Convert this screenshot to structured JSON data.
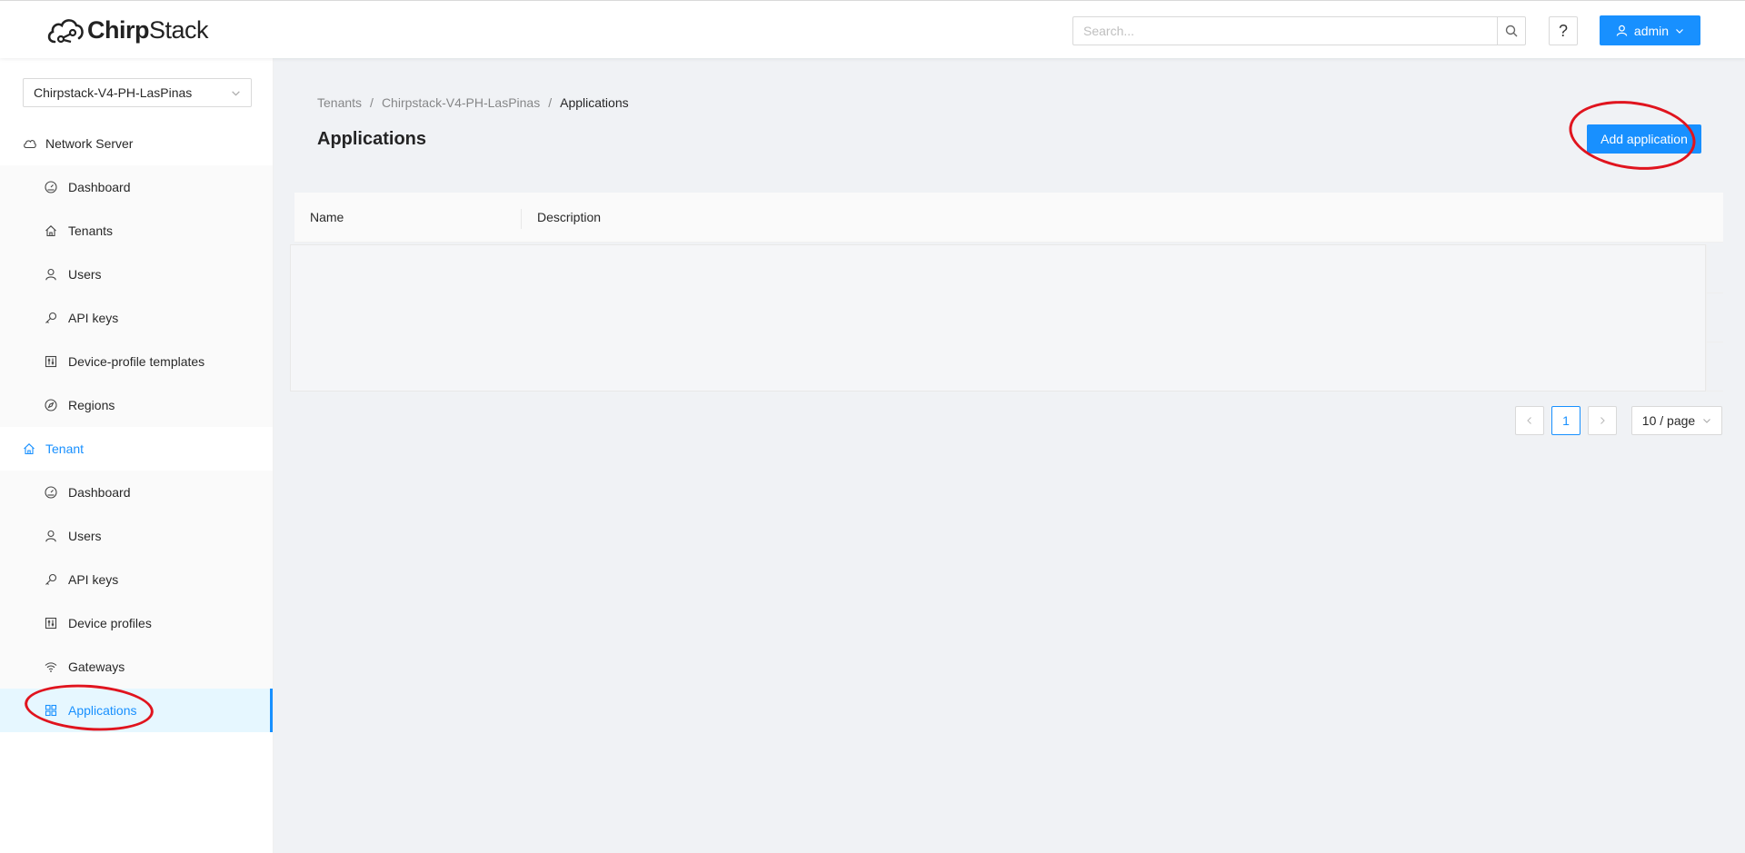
{
  "header": {
    "logo_text_bold": "Chirp",
    "logo_text": "Stack",
    "search_placeholder": "Search...",
    "help_label": "?",
    "user_label": "admin"
  },
  "sidebar": {
    "tenant_select": "Chirpstack-V4-PH-LasPinas",
    "network_server": {
      "title": "Network Server",
      "items": [
        {
          "label": "Dashboard",
          "icon": "dashboard-icon"
        },
        {
          "label": "Tenants",
          "icon": "home-icon"
        },
        {
          "label": "Users",
          "icon": "user-icon"
        },
        {
          "label": "API keys",
          "icon": "key-icon"
        },
        {
          "label": "Device-profile templates",
          "icon": "control-icon"
        },
        {
          "label": "Regions",
          "icon": "compass-icon"
        }
      ]
    },
    "tenant": {
      "title": "Tenant",
      "items": [
        {
          "label": "Dashboard",
          "icon": "dashboard-icon"
        },
        {
          "label": "Users",
          "icon": "user-icon"
        },
        {
          "label": "API keys",
          "icon": "key-icon"
        },
        {
          "label": "Device profiles",
          "icon": "control-icon"
        },
        {
          "label": "Gateways",
          "icon": "wifi-icon"
        },
        {
          "label": "Applications",
          "icon": "appstore-icon",
          "selected": true
        }
      ]
    }
  },
  "breadcrumb": [
    "Tenants",
    "Chirpstack-V4-PH-LasPinas",
    "Applications"
  ],
  "page_title": "Applications",
  "add_button": "Add application",
  "table": {
    "columns": [
      "Name",
      "Description"
    ],
    "rows": []
  },
  "pagination": {
    "current_page": "1",
    "page_size": "10 / page"
  },
  "colors": {
    "primary": "#1890ff",
    "annotation": "#e0141e",
    "background": "#f0f2f5"
  }
}
